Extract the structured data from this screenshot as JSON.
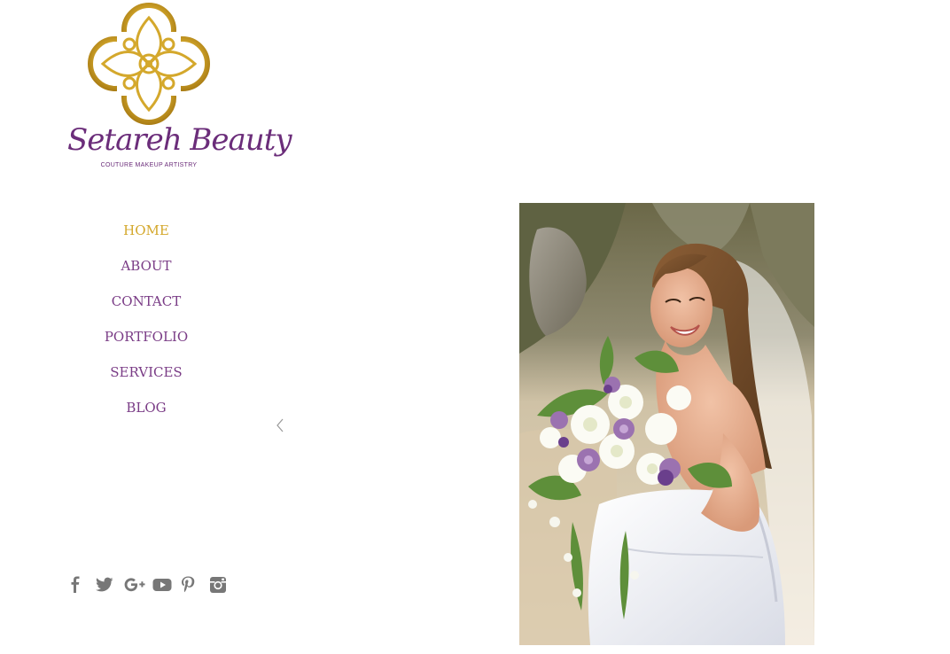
{
  "brand": {
    "name": "Setareh Beauty",
    "tagline": "COUTURE MAKEUP ARTISTRY"
  },
  "nav": {
    "items": [
      {
        "label": "HOME",
        "active": true
      },
      {
        "label": "ABOUT",
        "active": false
      },
      {
        "label": "CONTACT",
        "active": false
      },
      {
        "label": "PORTFOLIO",
        "active": false
      },
      {
        "label": "SERVICES",
        "active": false
      },
      {
        "label": "BLOG",
        "active": false
      }
    ]
  },
  "gallery": {
    "prev_icon": "chevron-left-icon",
    "image": "bride-with-bouquet-photo"
  },
  "social": [
    {
      "icon": "facebook-icon"
    },
    {
      "icon": "twitter-icon"
    },
    {
      "icon": "google-plus-icon"
    },
    {
      "icon": "youtube-icon"
    },
    {
      "icon": "pinterest-icon"
    },
    {
      "icon": "instagram-icon"
    }
  ],
  "colors": {
    "nav_text": "#7a3c86",
    "nav_active": "#d4a82c",
    "brand_purple": "#6b2d7a",
    "gold": "#d4a82c",
    "social_icon": "#777777"
  }
}
